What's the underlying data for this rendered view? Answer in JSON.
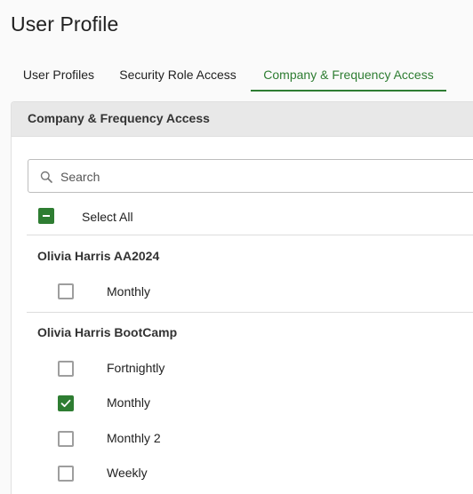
{
  "page": {
    "title": "User Profile"
  },
  "tabs": [
    {
      "label": "User Profiles",
      "active": false
    },
    {
      "label": "Security Role Access",
      "active": false
    },
    {
      "label": "Company & Frequency Access",
      "active": true
    }
  ],
  "panel": {
    "header": "Company & Frequency Access",
    "search": {
      "placeholder": "Search",
      "value": ""
    },
    "select_all": {
      "label": "Select All",
      "state": "indeterminate"
    },
    "groups": [
      {
        "name": "Olivia Harris AA2024",
        "items": [
          {
            "label": "Monthly",
            "checked": false
          }
        ]
      },
      {
        "name": "Olivia Harris BootCamp",
        "items": [
          {
            "label": "Fortnightly",
            "checked": false
          },
          {
            "label": "Monthly",
            "checked": true
          },
          {
            "label": "Monthly 2",
            "checked": false
          },
          {
            "label": "Weekly",
            "checked": false
          }
        ]
      }
    ]
  },
  "colors": {
    "accent": "#2e7d32",
    "header_bg": "#e8e8e8",
    "checkbox_border": "#9e9e9e"
  }
}
